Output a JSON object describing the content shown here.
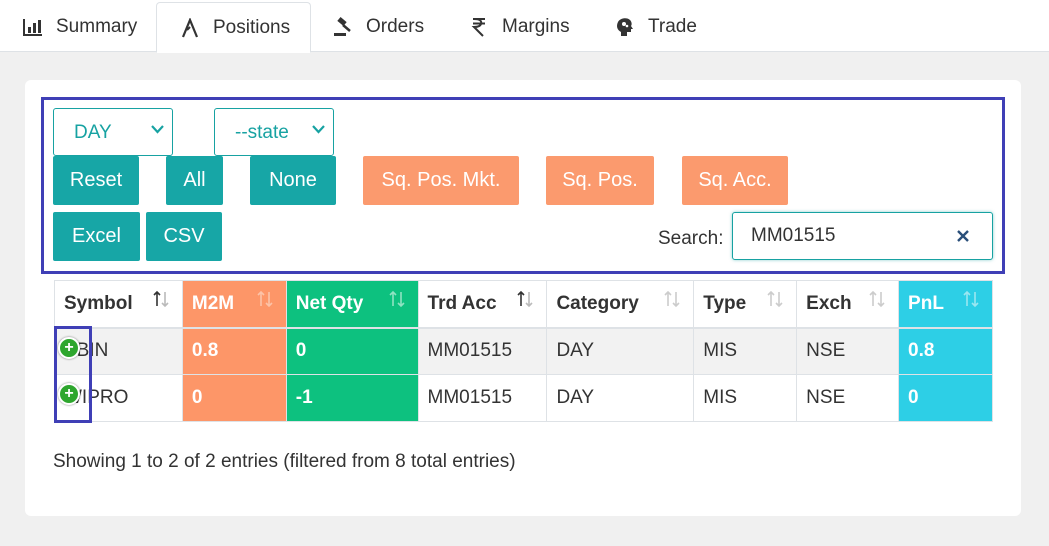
{
  "tabs": [
    {
      "label": "Summary",
      "icon": "bar-chart-icon"
    },
    {
      "label": "Positions",
      "icon": "position-icon",
      "active": true
    },
    {
      "label": "Orders",
      "icon": "gavel-icon"
    },
    {
      "label": "Margins",
      "icon": "rupee-icon"
    },
    {
      "label": "Trade",
      "icon": "brain-icon"
    }
  ],
  "filters": {
    "day_select": {
      "value": "DAY"
    },
    "state_select": {
      "value": "--state"
    }
  },
  "buttons": {
    "reset": "Reset",
    "all": "All",
    "none": "None",
    "sq_pos_mkt": "Sq. Pos. Mkt.",
    "sq_pos": "Sq. Pos.",
    "sq_acc": "Sq. Acc.",
    "excel": "Excel",
    "csv": "CSV"
  },
  "search": {
    "label": "Search:",
    "value": "MM01515"
  },
  "table": {
    "columns": [
      "Symbol",
      "M2M",
      "Net Qty",
      "Trd Acc",
      "Category",
      "Type",
      "Exch",
      "PnL"
    ],
    "rows": [
      [
        "SBIN",
        "0.8",
        "0",
        "MM01515",
        "DAY",
        "MIS",
        "NSE",
        "0.8"
      ],
      [
        "WIPRO",
        "0",
        "-1",
        "MM01515",
        "DAY",
        "MIS",
        "NSE",
        "0"
      ]
    ]
  },
  "info_text": "Showing 1 to 2 of 2 entries (filtered from 8 total entries)",
  "colors": {
    "teal": "#17a6a6",
    "orange": "#fb9a6e",
    "m2m": "#fd9668",
    "netqty": "#0dc17f",
    "pnl": "#2dcfe6",
    "highlight_frame": "#3f3fb6"
  }
}
